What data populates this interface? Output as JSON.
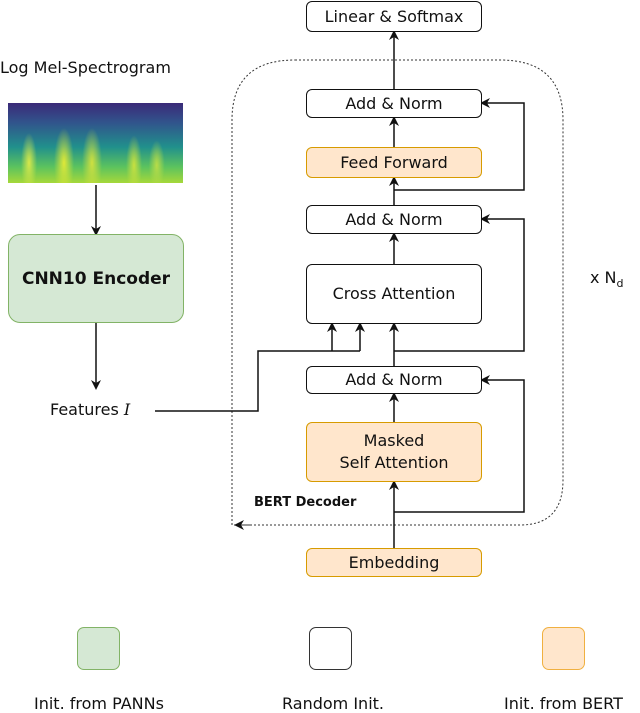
{
  "input": {
    "spectrogram_label": "Log Mel-Spectrogram",
    "encoder_label": "CNN10 Encoder",
    "features_label": "Features",
    "features_symbol": "I"
  },
  "decoder": {
    "group_label": "BERT Decoder",
    "repeat_label": "x N",
    "repeat_subscript": "d",
    "blocks": {
      "linear_softmax": "Linear & Softmax",
      "add_norm_top": "Add & Norm",
      "feed_forward": "Feed Forward",
      "add_norm_mid": "Add & Norm",
      "cross_attention": "Cross Attention",
      "add_norm_bottom": "Add & Norm",
      "masked_self_attention_line1": "Masked",
      "masked_self_attention_line2": "Self Attention",
      "embedding": "Embedding"
    }
  },
  "legend": [
    {
      "label": "Init. from PANNs",
      "fill": "#d5e8d4",
      "stroke": "#82b366"
    },
    {
      "label": "Random Init.",
      "fill": "#ffffff",
      "stroke": "#333333"
    },
    {
      "label": "Init. from BERT",
      "fill": "#ffe6cc",
      "stroke": "#d79b00"
    }
  ],
  "colors": {
    "pretrained_panns": "#d5e8d4",
    "pretrained_bert": "#ffe6cc",
    "random": "#ffffff"
  }
}
